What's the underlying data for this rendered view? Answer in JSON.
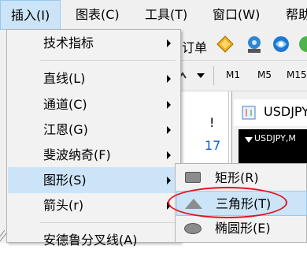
{
  "menubar": {
    "items": [
      "插入(I)",
      "图表(C)",
      "工具(T)",
      "窗口(W)",
      "帮助"
    ]
  },
  "background": {
    "toolbar_order_text": "订单",
    "timeframes": [
      "M1",
      "M5",
      "M15"
    ],
    "panel_exclaim": "!",
    "panel_number": "17",
    "chart_window_title": "USDJPY",
    "chart_inner_title": "USDJPY,M"
  },
  "dropdown": {
    "items": [
      {
        "label": "技术指标",
        "has_submenu": true
      },
      {
        "label": "直线(L)",
        "has_submenu": true
      },
      {
        "label": "通道(C)",
        "has_submenu": true
      },
      {
        "label": "江恩(G)",
        "has_submenu": true
      },
      {
        "label": "斐波纳奇(F)",
        "has_submenu": true
      },
      {
        "label": "图形(S)",
        "has_submenu": true
      },
      {
        "label": "箭头(r)",
        "has_submenu": true
      },
      {
        "label": "安德鲁分叉线(A)",
        "has_submenu": false
      }
    ]
  },
  "submenu": {
    "items": [
      {
        "label": "矩形(R)",
        "icon": "rectangle-icon"
      },
      {
        "label": "三角形(T)",
        "icon": "triangle-icon"
      },
      {
        "label": "椭圆形(E)",
        "icon": "ellipse-icon"
      }
    ]
  },
  "colors": {
    "highlight": "#cce4f7",
    "annotation_circle": "#e0141e",
    "link_blue": "#0a5fd0"
  }
}
